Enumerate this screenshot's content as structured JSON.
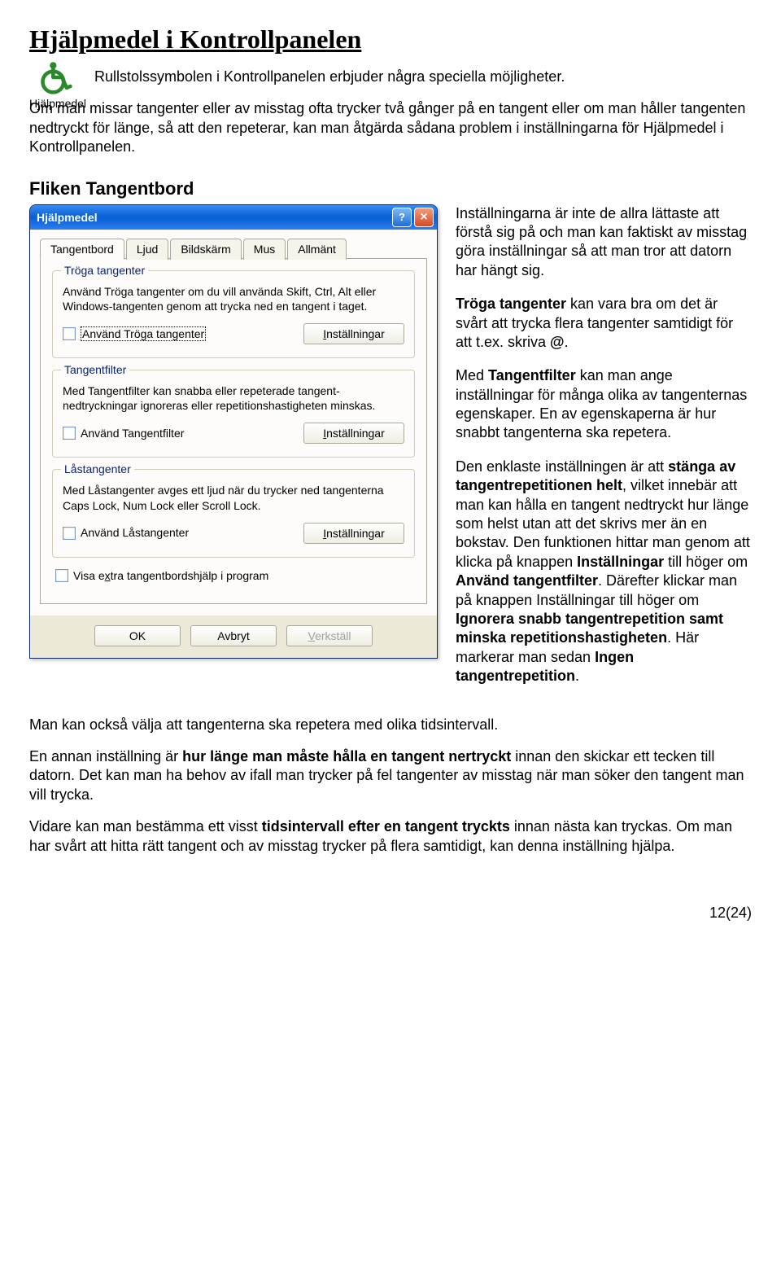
{
  "heading": "Hjälpmedel i Kontrollpanelen",
  "icon_label": "Hjälpmedel",
  "intro_line1": "Rullstolssymbolen i Kontrollpanelen erbjuder några speciella möjligheter.",
  "intro_line2": "Om man missar tangenter eller av misstag ofta trycker två gånger på en tangent eller om man håller tangenten nedtryckt för länge, så att den repeterar, kan man åtgärda sådana problem i inställningarna för Hjälpmedel i Kontrollpanelen.",
  "subheading": "Fliken Tangentbord",
  "dialog": {
    "title": "Hjälpmedel",
    "help_btn": "?",
    "close_btn": "×",
    "tabs": [
      "Tangentbord",
      "Ljud",
      "Bildskärm",
      "Mus",
      "Allmänt"
    ],
    "group1": {
      "title": "Tröga tangenter",
      "desc": "Använd Tröga tangenter om du vill använda Skift, Ctrl, Alt eller Windows-tangenten genom att trycka ned en tangent i taget.",
      "checkbox": "Använd Tröga tangenter",
      "button_pre": "I",
      "button_rest": "nställningar"
    },
    "group2": {
      "title": "Tangentfilter",
      "desc": "Med Tangentfilter kan snabba eller repeterade tangent-nedtryckningar ignoreras eller repetitionshastigheten minskas.",
      "checkbox": "Använd Tangentfilter",
      "button_pre": "I",
      "button_rest": "nställningar"
    },
    "group3": {
      "title": "Låstangenter",
      "desc": "Med Låstangenter avges ett ljud när du trycker ned tangenterna Caps Lock, Num Lock eller Scroll Lock.",
      "checkbox": "Använd Låstangenter",
      "button_pre": "I",
      "button_rest": "nställningar"
    },
    "extra_checkbox_pre": "Visa e",
    "extra_checkbox_u": "x",
    "extra_checkbox_post": "tra tangentbordshjälp i program",
    "ok": "OK",
    "cancel": "Avbryt",
    "apply_u": "V",
    "apply_rest": "erkställ"
  },
  "side": {
    "p1": "Inställningarna är inte de allra lättaste att förstå sig på och man kan faktiskt av misstag göra inställningar så att man tror att datorn har hängt sig.",
    "p2a": "Tröga tangenter",
    "p2b": " kan vara bra om det är svårt att trycka flera tangenter samtidigt för att t.ex. skriva ",
    "p2c": "@",
    "p2d": ".",
    "p3a": "Med ",
    "p3b": "Tangentfilter",
    "p3c": " kan man ange inställningar för många olika av tangenternas egenskaper. En av egenskaperna är hur snabbt tangenterna ska repetera.",
    "p4a": "Den enklaste inställningen är att ",
    "p4b": "stänga av tangentrepetitionen helt",
    "p4c": ", vilket innebär att man kan hålla en tangent nedtryckt hur länge som helst utan att det skrivs mer än en bokstav. Den funktionen hittar man genom att klicka på knappen ",
    "p4d": "Inställningar",
    "p4e": " till höger om ",
    "p4f": "Använd tangentfilter",
    "p4g": ". Därefter klickar man på knappen Inställningar till höger om ",
    "p4h": "Ignorera snabb tangentrepetition samt minska repetitionshastigheten",
    "p4i": ". Här markerar man sedan ",
    "p4j": "Ingen tangentrepetition",
    "p4k": "."
  },
  "after1": "Man kan också välja att tangenterna ska repetera med olika tidsintervall.",
  "after2a": "En annan inställning är ",
  "after2b": "hur länge man måste hålla en tangent nertryckt",
  "after2c": " innan den skickar ett tecken till datorn. Det kan man ha behov av ifall man trycker på fel tangenter av misstag när man söker den tangent man vill trycka.",
  "after3a": "Vidare kan man bestämma ett visst ",
  "after3b": "tidsintervall efter en tangent tryckts",
  "after3c": " innan nästa kan tryckas. Om man har svårt att hitta rätt tangent och av misstag trycker på flera samtidigt, kan denna inställning hjälpa.",
  "pagenum": "12(24)"
}
